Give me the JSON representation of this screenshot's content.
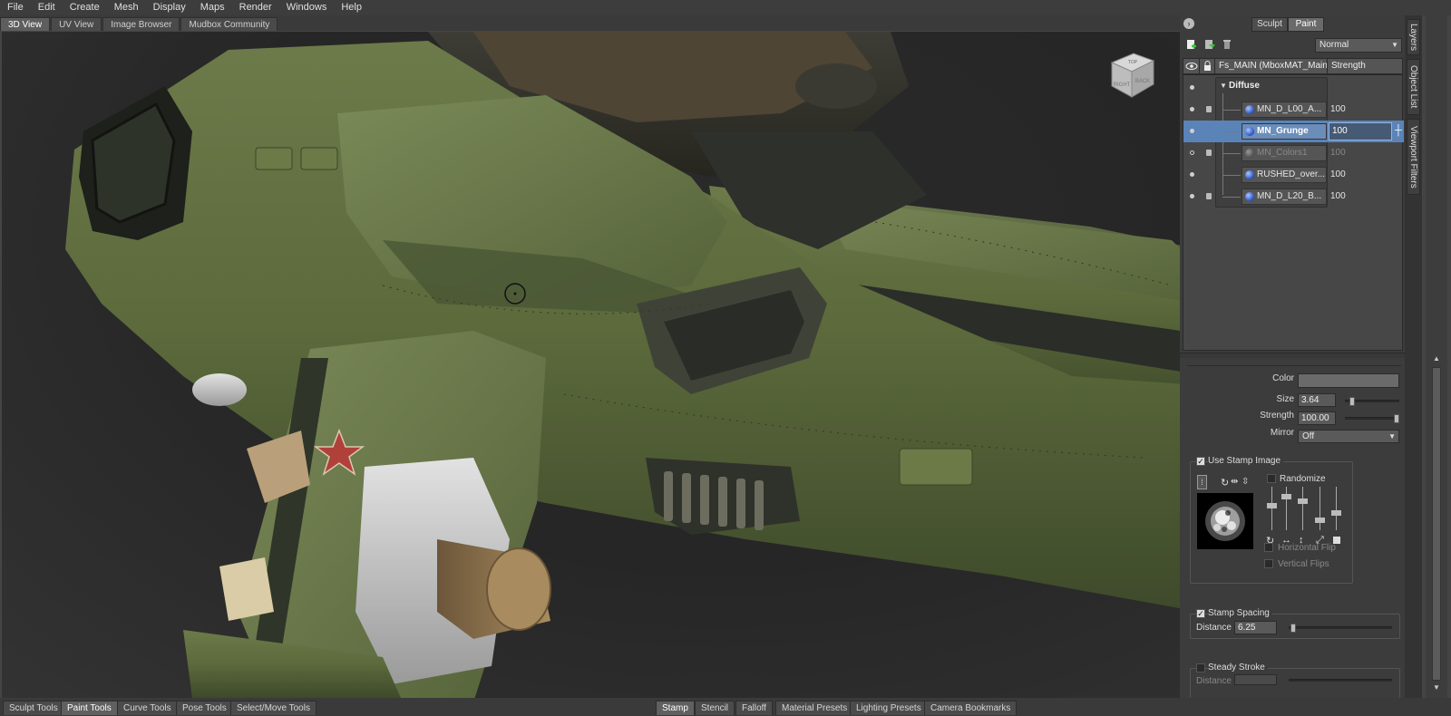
{
  "menu": [
    "File",
    "Edit",
    "Create",
    "Mesh",
    "Display",
    "Maps",
    "Render",
    "Windows",
    "Help"
  ],
  "view_tabs": [
    {
      "label": "3D View",
      "active": true
    },
    {
      "label": "UV View",
      "active": false
    },
    {
      "label": "Image Browser",
      "active": false
    },
    {
      "label": "Mudbox Community",
      "active": false
    }
  ],
  "navcube": {
    "faces": [
      "RIGHT",
      "BACK",
      "TOP"
    ]
  },
  "right_panel": {
    "mode_buttons": [
      "Sculpt",
      "Paint"
    ],
    "active_mode": "Paint",
    "blend_mode": "Normal",
    "layer_header": {
      "name": "Fs_MAIN (MboxMAT_Main",
      "strength": "Strength"
    },
    "group_name": "Diffuse",
    "layers": [
      {
        "name": "MN_D_L00_A...",
        "value": "100",
        "visible": true,
        "locked": true,
        "selected": false,
        "dim": false
      },
      {
        "name": "MN_Grunge",
        "value": "100",
        "visible": true,
        "locked": false,
        "selected": true,
        "dim": false
      },
      {
        "name": "MN_Colors1",
        "value": "100",
        "visible": false,
        "locked": true,
        "selected": false,
        "dim": true
      },
      {
        "name": "RUSHED_over...",
        "value": "100",
        "visible": true,
        "locked": false,
        "selected": false,
        "dim": false
      },
      {
        "name": "MN_D_L20_B...",
        "value": "100",
        "visible": true,
        "locked": true,
        "selected": false,
        "dim": false
      }
    ],
    "properties": {
      "color_label": "Color",
      "size_label": "Size",
      "size_value": "3.64",
      "size_level": 0.1,
      "strength_label": "Strength",
      "strength_value": "100.00",
      "strength_level": 1.0,
      "mirror_label": "Mirror",
      "mirror_value": "Off"
    },
    "stamp": {
      "use_stamp_label": "Use Stamp Image",
      "randomize_label": "Randomize",
      "horizontal_flip_label": "Horizontal Flip",
      "vertical_flips_label": "Vertical Flips"
    },
    "spacing": {
      "label": "Stamp Spacing",
      "distance_label": "Distance",
      "distance_value": "6.25",
      "distance_level": 0.02
    },
    "steady": {
      "label": "Steady Stroke",
      "distance_label": "Distance"
    }
  },
  "side_tabs": [
    "Layers",
    "Object List",
    "Viewport Filters"
  ],
  "bottom_left_tabs": [
    {
      "label": "Sculpt Tools",
      "active": false
    },
    {
      "label": "Paint Tools",
      "active": true
    },
    {
      "label": "Curve Tools",
      "active": false
    },
    {
      "label": "Pose Tools",
      "active": false
    },
    {
      "label": "Select/Move Tools",
      "active": false
    }
  ],
  "bottom_right_tabs": [
    {
      "label": "Stamp",
      "active": true
    },
    {
      "label": "Stencil",
      "active": false
    },
    {
      "label": "Falloff",
      "active": false
    },
    {
      "label": "Material Presets",
      "active": false
    },
    {
      "label": "Lighting Presets",
      "active": false
    },
    {
      "label": "Camera Bookmarks",
      "active": false
    }
  ],
  "colors": {
    "accent": "#5a84b8",
    "model_green": "#5e6b3e",
    "star_red": "#b0413a"
  }
}
